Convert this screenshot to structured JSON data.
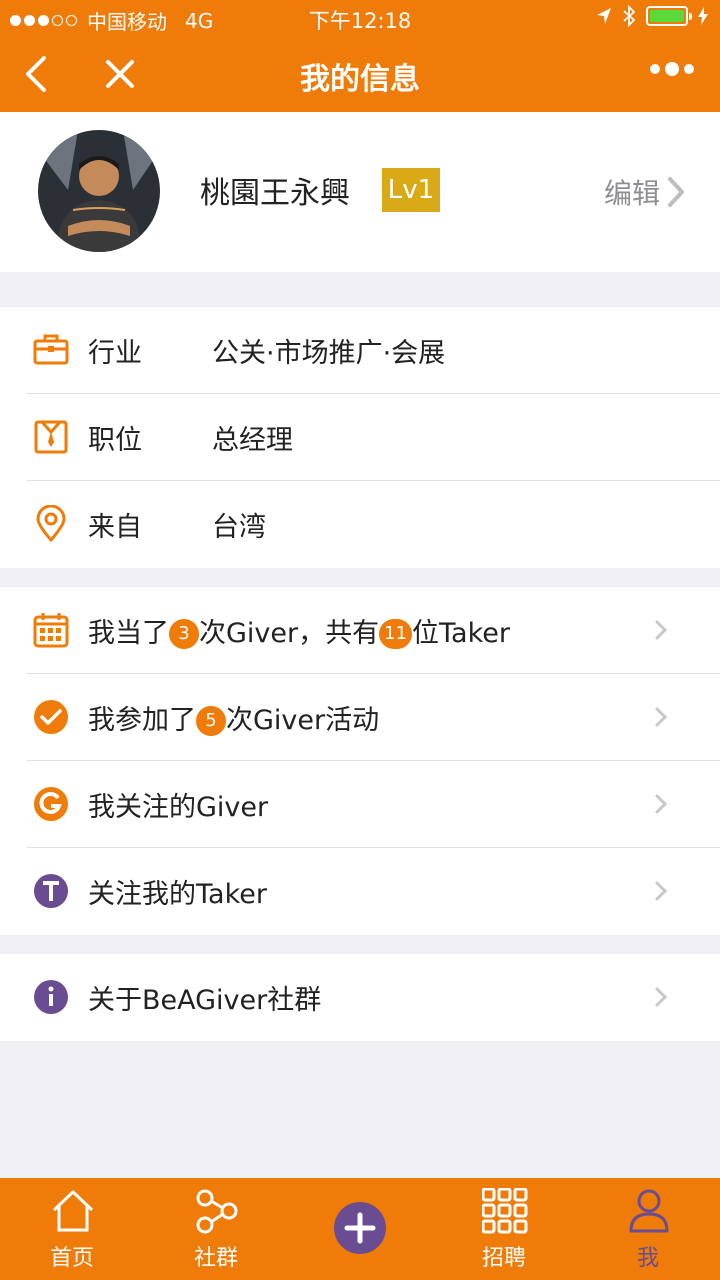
{
  "status": {
    "carrier": "中国移动",
    "network": "4G",
    "time": "下午12:18"
  },
  "nav": {
    "title": "我的信息"
  },
  "profile": {
    "name": "桃園王永興",
    "level": "Lv1",
    "edit_label": "编辑"
  },
  "info": [
    {
      "label": "行业",
      "value": "公关·市场推广·会展",
      "icon": "briefcase-icon"
    },
    {
      "label": "职位",
      "value": "总经理",
      "icon": "shirt-tie-icon"
    },
    {
      "label": "来自",
      "value": "台湾",
      "icon": "location-pin-icon"
    }
  ],
  "stats": {
    "giver_times": {
      "pre": "我当了",
      "count1": "3",
      "mid": "次Giver，共有",
      "count2": "11",
      "post": "位Taker"
    },
    "events": {
      "pre": "我参加了",
      "count": "5",
      "post": "次Giver活动"
    },
    "following": "我关注的Giver",
    "followers": "关注我的Taker"
  },
  "about": "关于BeAGiver社群",
  "tabs": [
    {
      "label": "首页",
      "icon": "home-icon"
    },
    {
      "label": "社群",
      "icon": "share-nodes-icon"
    },
    {
      "label": "",
      "icon": "plus-icon"
    },
    {
      "label": "招聘",
      "icon": "grid-icon"
    },
    {
      "label": "我",
      "icon": "person-icon"
    }
  ],
  "colors": {
    "accent": "#ef7b08",
    "purple": "#6a4c93",
    "level_badge": "#d9a918"
  }
}
